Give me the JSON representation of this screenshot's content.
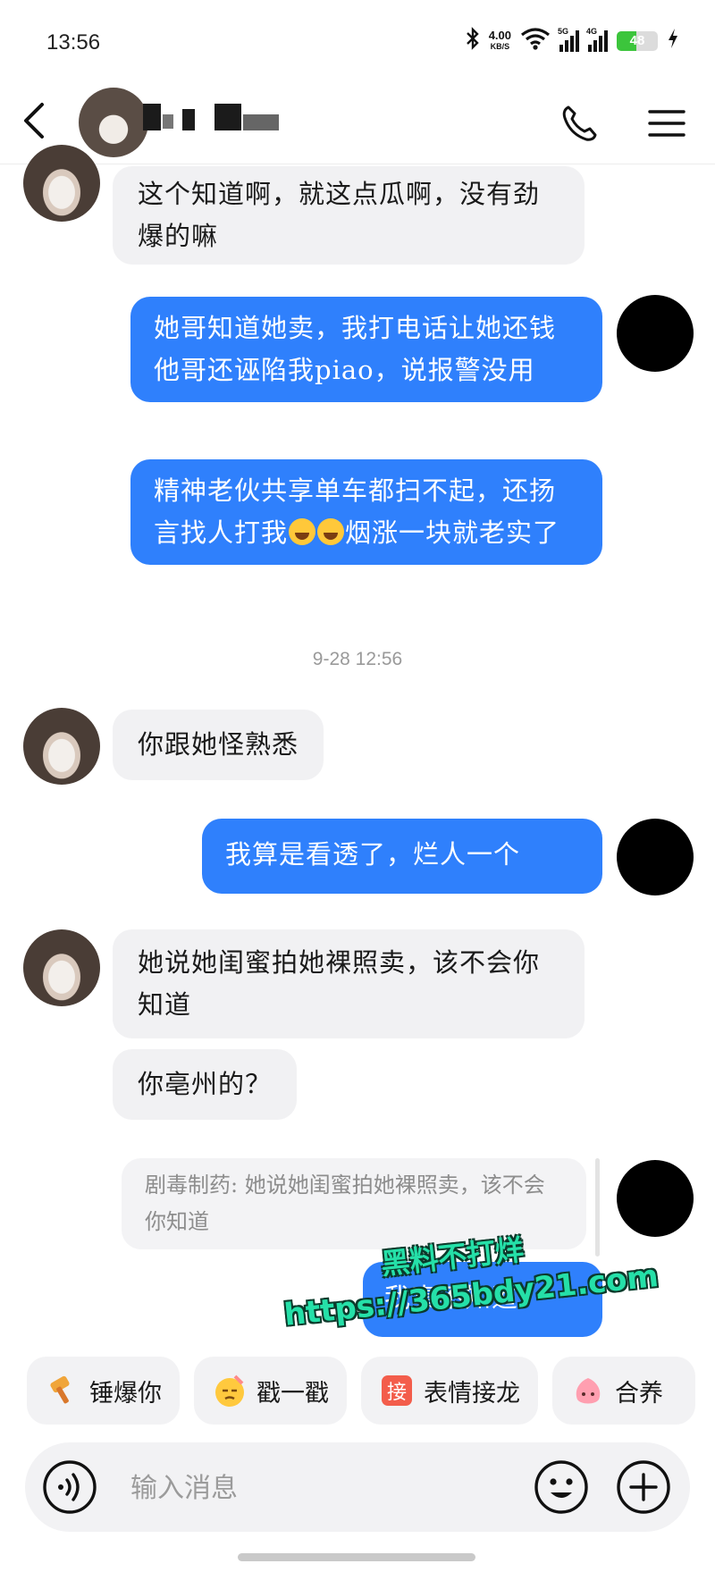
{
  "status_bar": {
    "time": "13:56",
    "net_speed_value": "4.00",
    "net_speed_unit": "KB/S",
    "sim1_tag": "5G",
    "sim2_tag": "4G",
    "battery": "48"
  },
  "header": {
    "contact_name": ""
  },
  "messages": {
    "m1": "这个知道啊，就这点瓜啊，没有劲爆的嘛",
    "m2": "她哥知道她卖，我打电话让她还钱他哥还诬陷我piao，说报警没用",
    "m3_part1": "精神老伙共享单车都扫不起，还扬言找人打我",
    "m3_part2": "烟涨一块就老实了",
    "timestamp": "9-28 12:56",
    "m4": "你跟她怪熟悉",
    "m5": "我算是看透了，烂人一个",
    "m6": "她说她闺蜜拍她裸照卖，该不会你知道",
    "m7": "你亳州的？",
    "quote": "剧毒制药: 她说她闺蜜拍她裸照卖，该不会你知道",
    "m8_visible": "我真不知道"
  },
  "watermark": {
    "line1": "黑料不打烊",
    "line2": "https://365bdy21.com"
  },
  "quick_actions": [
    "锤爆你",
    "戳一戳",
    "表情接龙",
    "合养"
  ],
  "quick_action_badge": "接",
  "input": {
    "placeholder": "输入消息"
  },
  "colors": {
    "outgoing_bubble": "#2f80fc",
    "incoming_bubble": "#f1f1f3",
    "battery_green": "#3cc53c",
    "watermark_green": "#25e0a8"
  },
  "icons": [
    "back-arrow-icon",
    "phone-icon",
    "menu-icon",
    "voice-icon",
    "emoji-icon",
    "plus-icon",
    "bluetooth-icon",
    "wifi-icon",
    "charging-icon"
  ]
}
